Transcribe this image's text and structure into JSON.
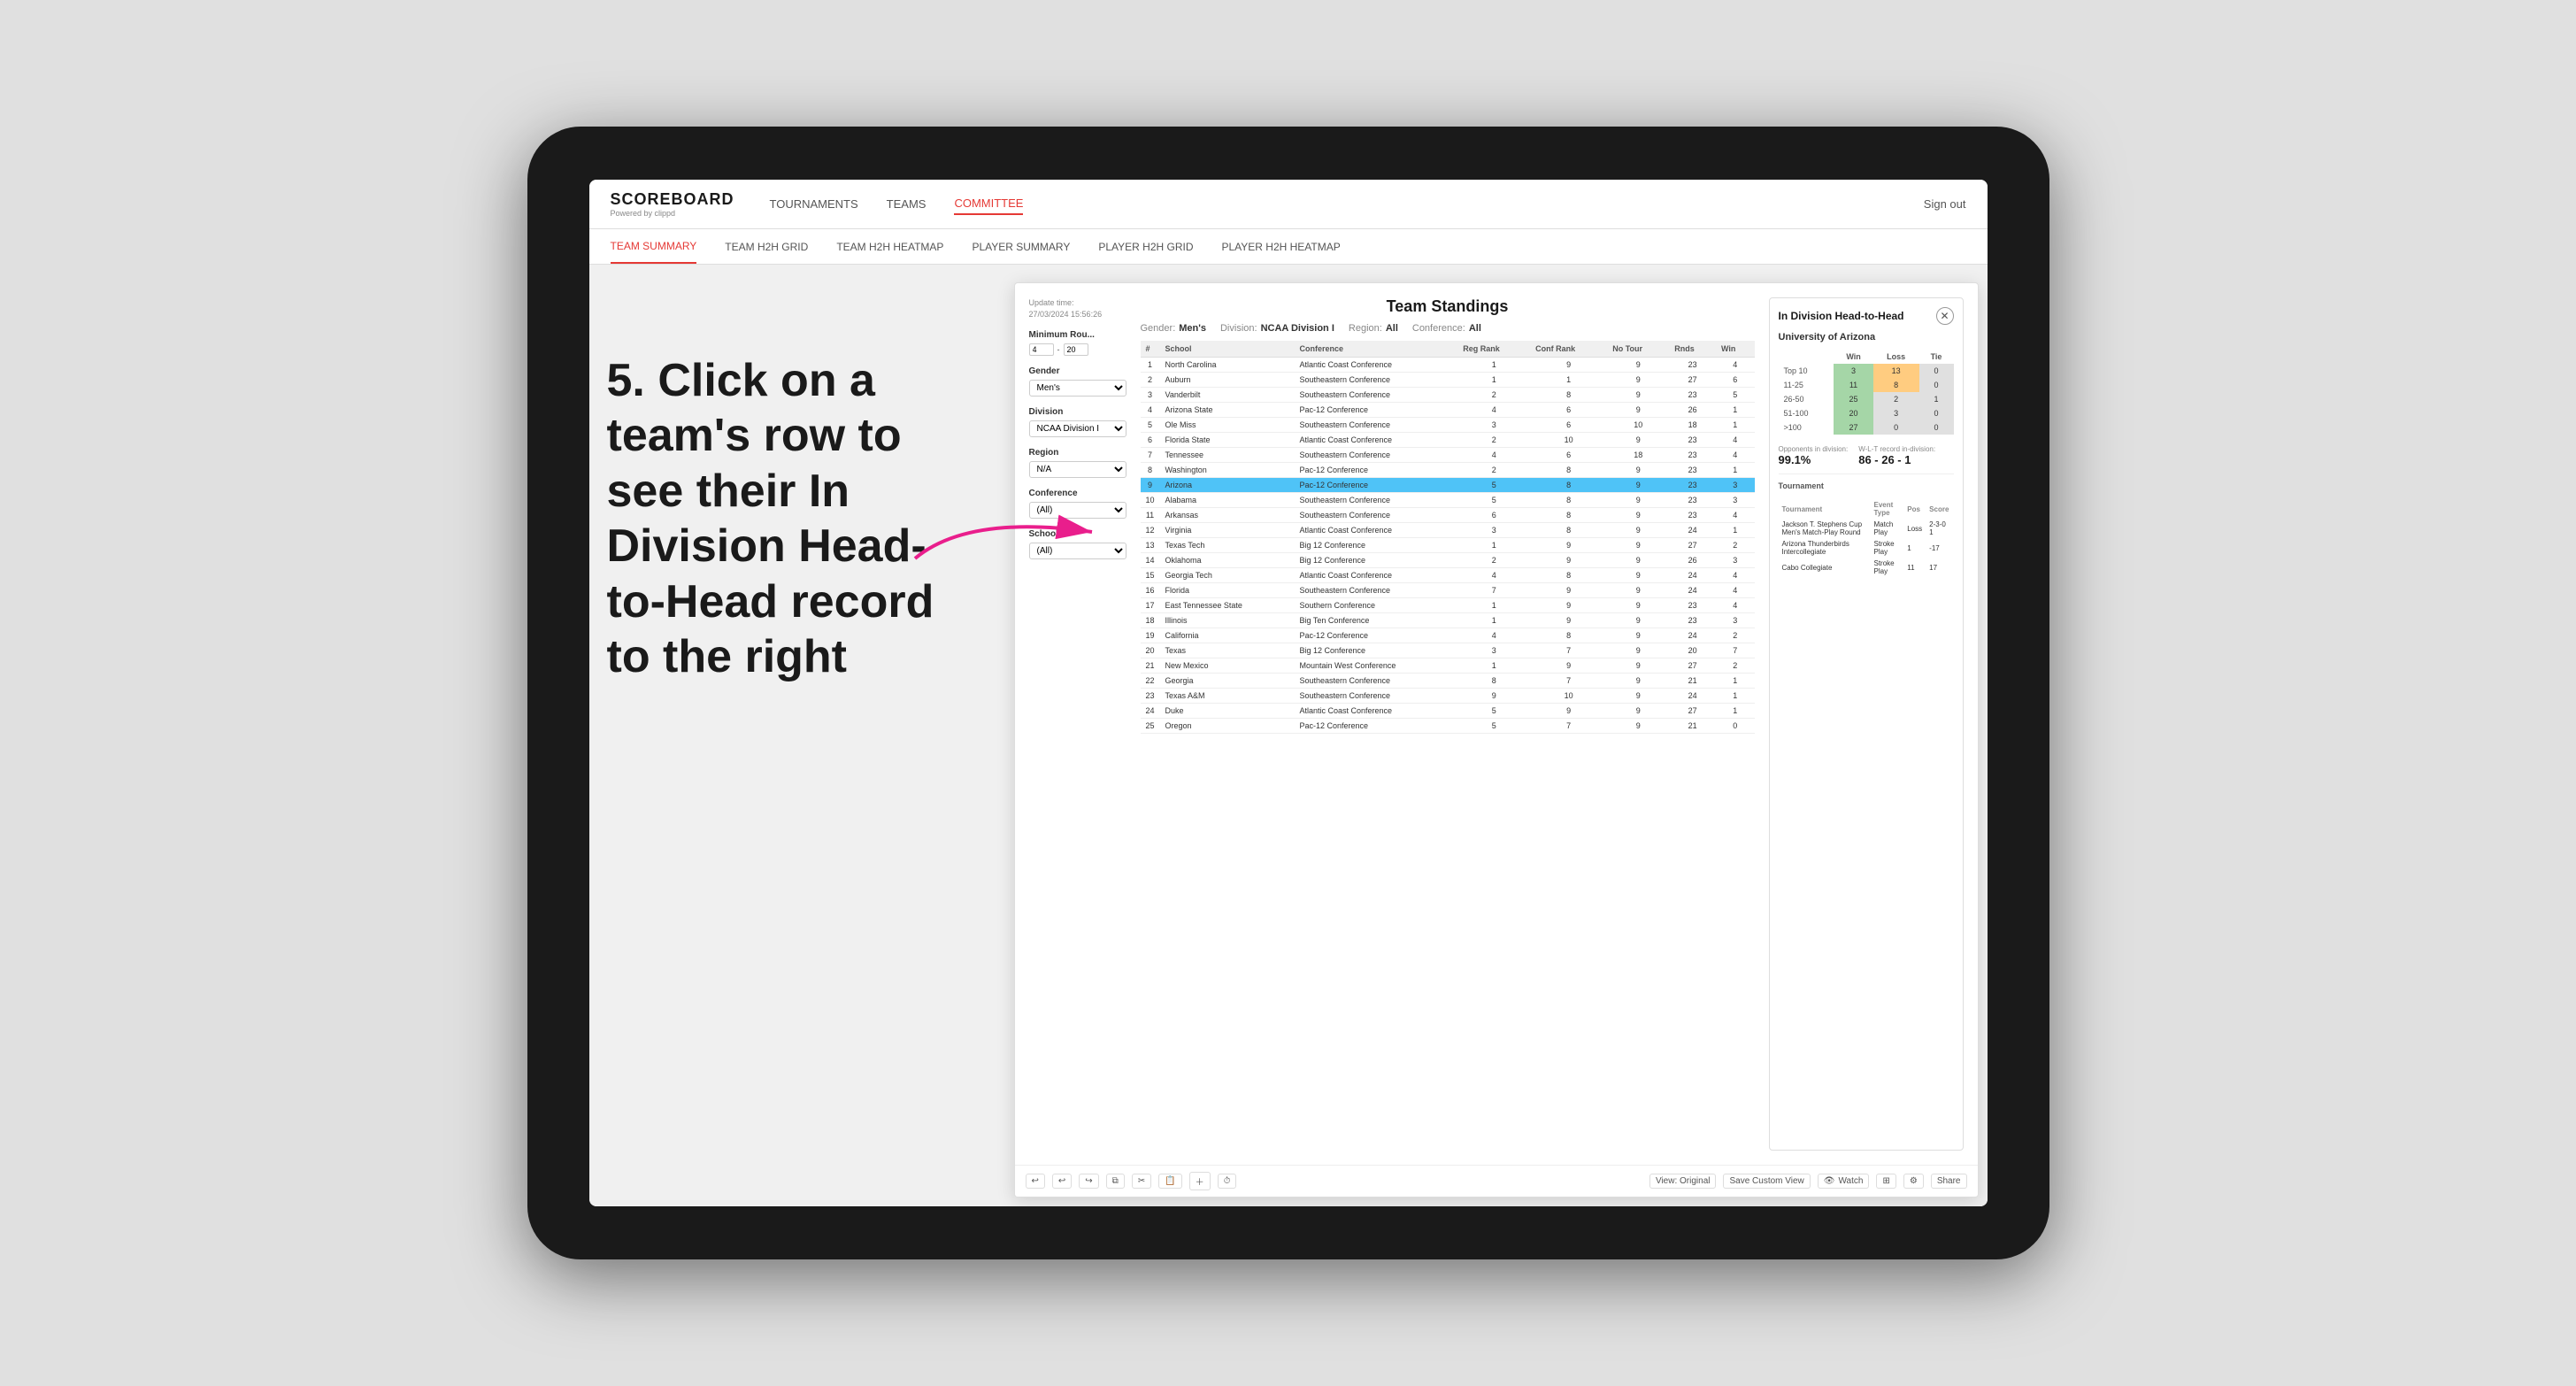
{
  "page": {
    "background": "#e0e0e0"
  },
  "nav": {
    "logo": "SCOREBOARD",
    "logo_sub": "Powered by clippd",
    "links": [
      "TOURNAMENTS",
      "TEAMS",
      "COMMITTEE"
    ],
    "active_link": "COMMITTEE",
    "sign_out": "Sign out"
  },
  "sub_nav": {
    "links": [
      "TEAM SUMMARY",
      "TEAM H2H GRID",
      "TEAM H2H HEATMAP",
      "PLAYER SUMMARY",
      "PLAYER H2H GRID",
      "PLAYER H2H HEATMAP"
    ],
    "active_link": "PLAYER SUMMARY"
  },
  "instruction": {
    "text": "5. Click on a team's row to see their In Division Head-to-Head record to the right"
  },
  "standings": {
    "title": "Team Standings",
    "update_time_label": "Update time:",
    "update_time": "27/03/2024 15:56:26",
    "gender_label": "Gender:",
    "gender_value": "Men's",
    "division_label": "Division:",
    "division_value": "NCAA Division I",
    "region_label": "Region:",
    "region_value": "All",
    "conference_label": "Conference:",
    "conference_value": "All"
  },
  "filters": {
    "min_rounds_label": "Minimum Rou...",
    "min_rounds_min": "4",
    "min_rounds_max": "20",
    "gender_label": "Gender",
    "gender_value": "Men's",
    "division_label": "Division",
    "division_value": "NCAA Division I",
    "region_label": "Region",
    "region_value": "N/A",
    "conference_label": "Conference",
    "conference_value": "(All)",
    "school_label": "School",
    "school_value": "(All)"
  },
  "table": {
    "headers": [
      "#",
      "School",
      "Conference",
      "Reg Rank",
      "Conf Rank",
      "No Tour",
      "Rnds",
      "Win"
    ],
    "rows": [
      {
        "rank": 1,
        "school": "North Carolina",
        "conference": "Atlantic Coast Conference",
        "reg_rank": 1,
        "conf_rank": 9,
        "no_tour": 9,
        "rnds": 23,
        "win": 4
      },
      {
        "rank": 2,
        "school": "Auburn",
        "conference": "Southeastern Conference",
        "reg_rank": 1,
        "conf_rank": 1,
        "no_tour": 9,
        "rnds": 27,
        "win": 6
      },
      {
        "rank": 3,
        "school": "Vanderbilt",
        "conference": "Southeastern Conference",
        "reg_rank": 2,
        "conf_rank": 8,
        "no_tour": 9,
        "rnds": 23,
        "win": 5
      },
      {
        "rank": 4,
        "school": "Arizona State",
        "conference": "Pac-12 Conference",
        "reg_rank": 4,
        "conf_rank": 6,
        "no_tour": 9,
        "rnds": 26,
        "win": 1
      },
      {
        "rank": 5,
        "school": "Ole Miss",
        "conference": "Southeastern Conference",
        "reg_rank": 3,
        "conf_rank": 6,
        "no_tour": 10,
        "rnds": 18,
        "win": 1
      },
      {
        "rank": 6,
        "school": "Florida State",
        "conference": "Atlantic Coast Conference",
        "reg_rank": 2,
        "conf_rank": 10,
        "no_tour": 9,
        "rnds": 23,
        "win": 4
      },
      {
        "rank": 7,
        "school": "Tennessee",
        "conference": "Southeastern Conference",
        "reg_rank": 4,
        "conf_rank": 6,
        "no_tour": 18,
        "rnds": 23,
        "win": 4
      },
      {
        "rank": 8,
        "school": "Washington",
        "conference": "Pac-12 Conference",
        "reg_rank": 2,
        "conf_rank": 8,
        "no_tour": 9,
        "rnds": 23,
        "win": 1
      },
      {
        "rank": 9,
        "school": "Arizona",
        "conference": "Pac-12 Conference",
        "reg_rank": 5,
        "conf_rank": 8,
        "no_tour": 9,
        "rnds": 23,
        "win": 3,
        "highlighted": true
      },
      {
        "rank": 10,
        "school": "Alabama",
        "conference": "Southeastern Conference",
        "reg_rank": 5,
        "conf_rank": 8,
        "no_tour": 9,
        "rnds": 23,
        "win": 3
      },
      {
        "rank": 11,
        "school": "Arkansas",
        "conference": "Southeastern Conference",
        "reg_rank": 6,
        "conf_rank": 8,
        "no_tour": 9,
        "rnds": 23,
        "win": 4
      },
      {
        "rank": 12,
        "school": "Virginia",
        "conference": "Atlantic Coast Conference",
        "reg_rank": 3,
        "conf_rank": 8,
        "no_tour": 9,
        "rnds": 24,
        "win": 1
      },
      {
        "rank": 13,
        "school": "Texas Tech",
        "conference": "Big 12 Conference",
        "reg_rank": 1,
        "conf_rank": 9,
        "no_tour": 9,
        "rnds": 27,
        "win": 2
      },
      {
        "rank": 14,
        "school": "Oklahoma",
        "conference": "Big 12 Conference",
        "reg_rank": 2,
        "conf_rank": 9,
        "no_tour": 9,
        "rnds": 26,
        "win": 3
      },
      {
        "rank": 15,
        "school": "Georgia Tech",
        "conference": "Atlantic Coast Conference",
        "reg_rank": 4,
        "conf_rank": 8,
        "no_tour": 9,
        "rnds": 24,
        "win": 4
      },
      {
        "rank": 16,
        "school": "Florida",
        "conference": "Southeastern Conference",
        "reg_rank": 7,
        "conf_rank": 9,
        "no_tour": 9,
        "rnds": 24,
        "win": 4
      },
      {
        "rank": 17,
        "school": "East Tennessee State",
        "conference": "Southern Conference",
        "reg_rank": 1,
        "conf_rank": 9,
        "no_tour": 9,
        "rnds": 23,
        "win": 4
      },
      {
        "rank": 18,
        "school": "Illinois",
        "conference": "Big Ten Conference",
        "reg_rank": 1,
        "conf_rank": 9,
        "no_tour": 9,
        "rnds": 23,
        "win": 3
      },
      {
        "rank": 19,
        "school": "California",
        "conference": "Pac-12 Conference",
        "reg_rank": 4,
        "conf_rank": 8,
        "no_tour": 9,
        "rnds": 24,
        "win": 2
      },
      {
        "rank": 20,
        "school": "Texas",
        "conference": "Big 12 Conference",
        "reg_rank": 3,
        "conf_rank": 7,
        "no_tour": 9,
        "rnds": 20,
        "win": 7
      },
      {
        "rank": 21,
        "school": "New Mexico",
        "conference": "Mountain West Conference",
        "reg_rank": 1,
        "conf_rank": 9,
        "no_tour": 9,
        "rnds": 27,
        "win": 2
      },
      {
        "rank": 22,
        "school": "Georgia",
        "conference": "Southeastern Conference",
        "reg_rank": 8,
        "conf_rank": 7,
        "no_tour": 9,
        "rnds": 21,
        "win": 1
      },
      {
        "rank": 23,
        "school": "Texas A&M",
        "conference": "Southeastern Conference",
        "reg_rank": 9,
        "conf_rank": 10,
        "no_tour": 9,
        "rnds": 24,
        "win": 1
      },
      {
        "rank": 24,
        "school": "Duke",
        "conference": "Atlantic Coast Conference",
        "reg_rank": 5,
        "conf_rank": 9,
        "no_tour": 9,
        "rnds": 27,
        "win": 1
      },
      {
        "rank": 25,
        "school": "Oregon",
        "conference": "Pac-12 Conference",
        "reg_rank": 5,
        "conf_rank": 7,
        "no_tour": 9,
        "rnds": 21,
        "win": 0
      }
    ]
  },
  "h2h": {
    "title": "In Division Head-to-Head",
    "team": "University of Arizona",
    "col_headers": [
      "Win",
      "Loss",
      "Tie"
    ],
    "rows": [
      {
        "label": "Top 10",
        "win": 3,
        "loss": 13,
        "tie": 0,
        "win_color": "green",
        "loss_color": "orange"
      },
      {
        "label": "11-25",
        "win": 11,
        "loss": 8,
        "tie": 0,
        "win_color": "green",
        "loss_color": "orange"
      },
      {
        "label": "26-50",
        "win": 25,
        "loss": 2,
        "tie": 1,
        "win_color": "green",
        "loss_color": "gray"
      },
      {
        "label": "51-100",
        "win": 20,
        "loss": 3,
        "tie": 0,
        "win_color": "green",
        "loss_color": "gray"
      },
      {
        "label": ">100",
        "win": 27,
        "loss": 0,
        "tie": 0,
        "win_color": "green",
        "loss_color": "gray"
      }
    ],
    "opponents_label": "Opponents in division:",
    "opponents_value": "99.1%",
    "record_label": "W-L-T record in-division:",
    "record_value": "86 - 26 - 1",
    "tournaments_label": "Tournament",
    "tournaments_headers": [
      "Tournament",
      "Event Type",
      "Pos",
      "Score"
    ],
    "tournaments": [
      {
        "name": "Jackson T. Stephens Cup Men's Match-Play Round",
        "event_type": "Match Play",
        "pos": "Loss",
        "score": "2-3-0 1"
      },
      {
        "name": "Arizona Thunderbirds Intercollegiate",
        "event_type": "Stroke Play",
        "pos": "1",
        "score": "-17"
      },
      {
        "name": "Cabo Collegiate",
        "event_type": "Stroke Play",
        "pos": "11",
        "score": "17"
      }
    ]
  },
  "bottom_toolbar": {
    "undo": "↩",
    "redo": "↪",
    "view_original": "View: Original",
    "save_custom_view": "Save Custom View",
    "watch": "Watch",
    "share": "Share"
  }
}
